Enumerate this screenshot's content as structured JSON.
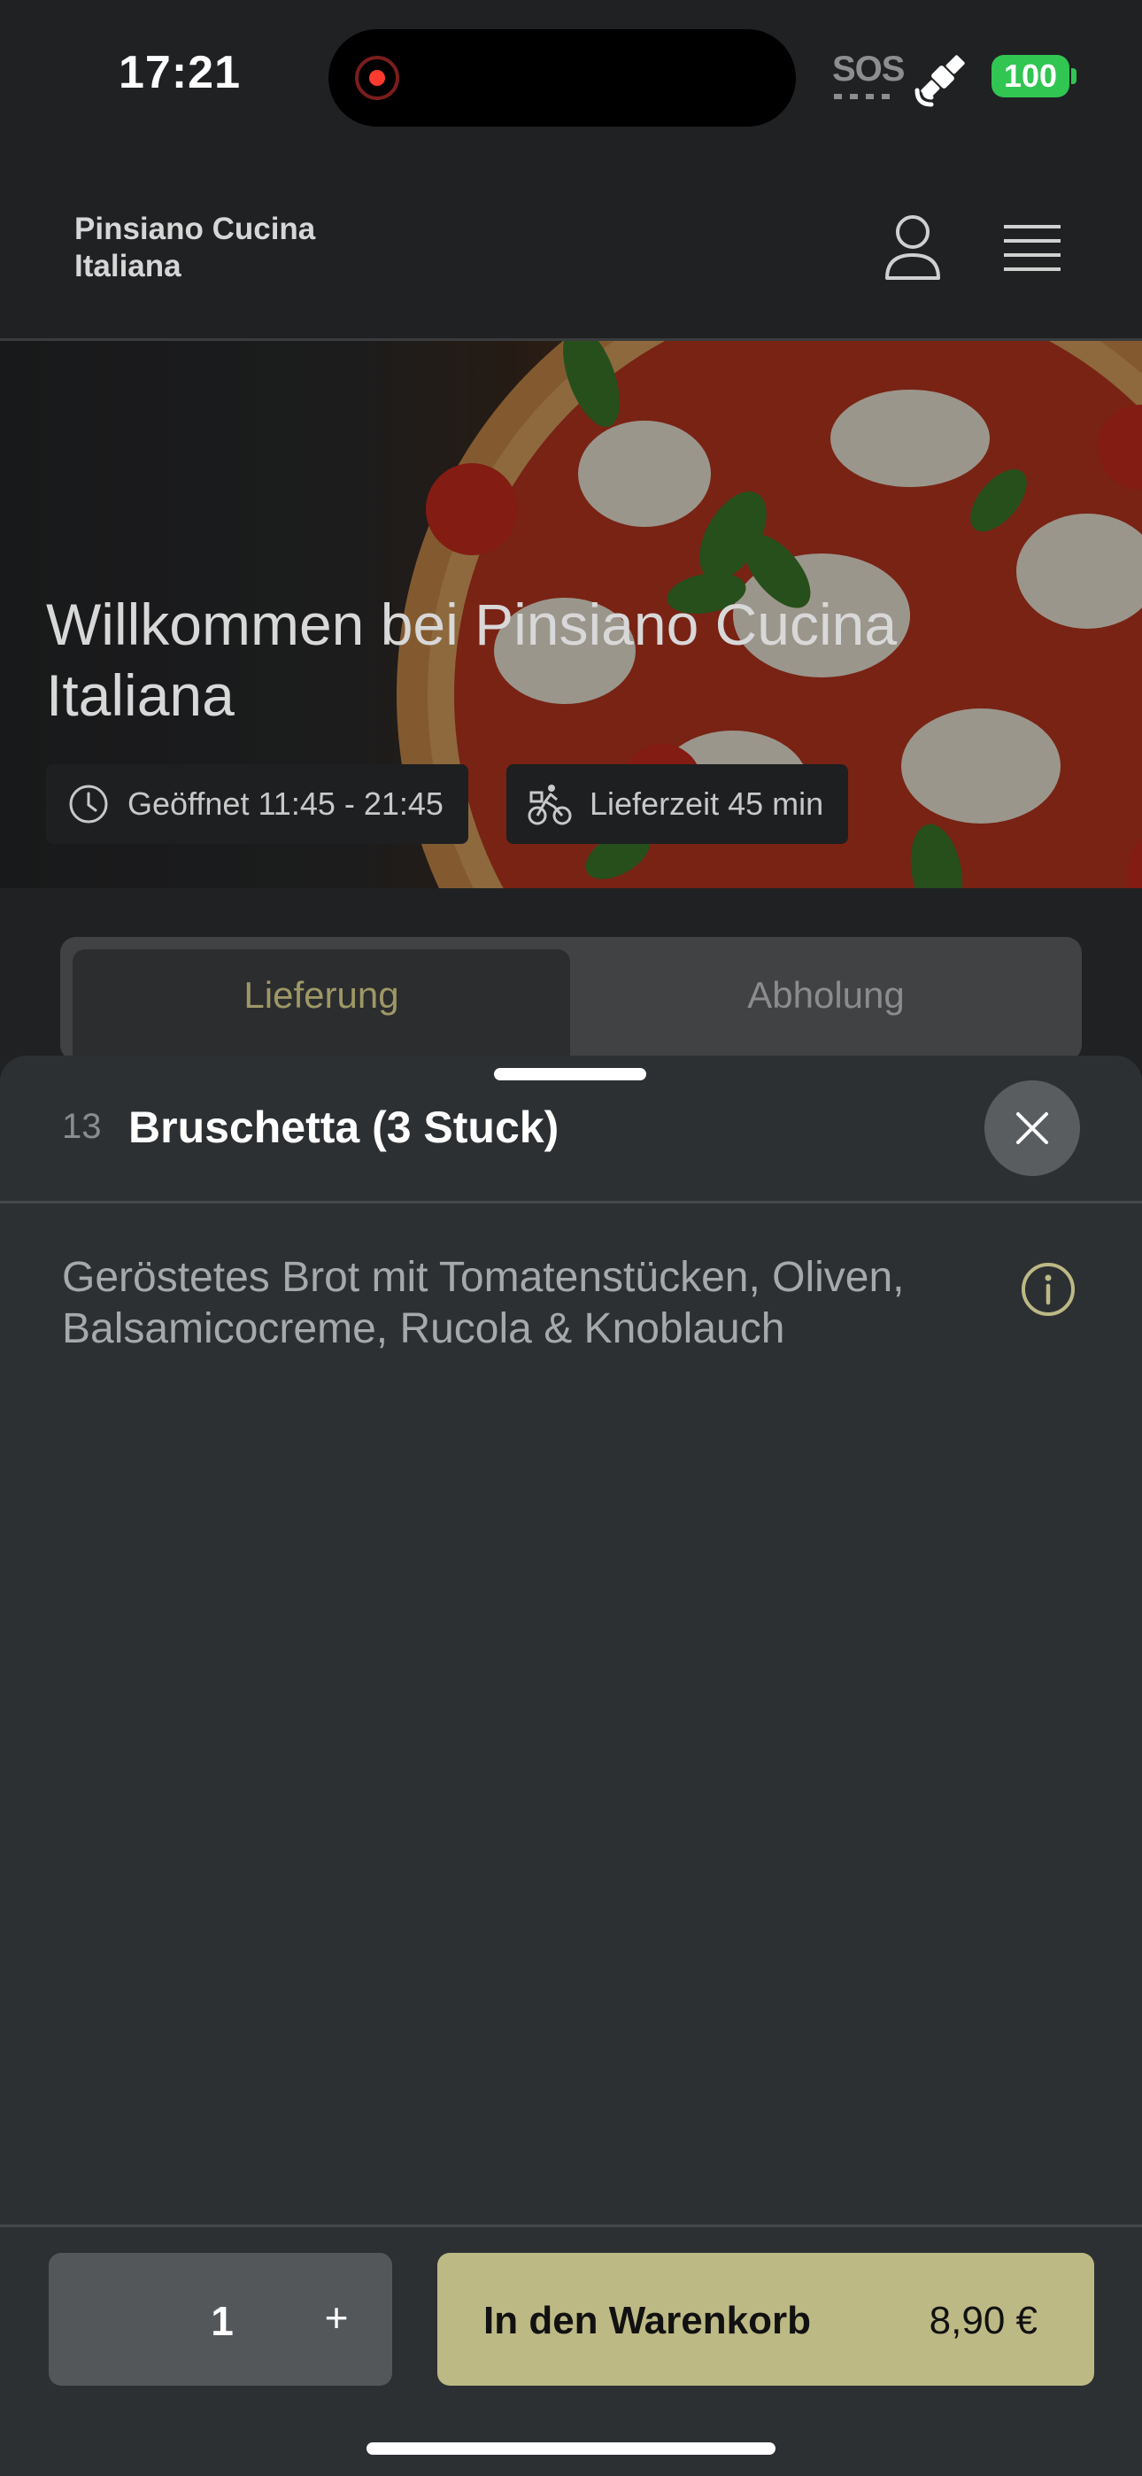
{
  "status_bar": {
    "time": "17:21",
    "sos": "SOS",
    "battery": "100",
    "colors": {
      "battery": "#31c552",
      "recording": "#ff3b30"
    }
  },
  "header": {
    "brand_line1": "Pinsiano Cucina",
    "brand_line2": "Italiana",
    "icons": [
      "user-icon",
      "menu-icon"
    ]
  },
  "hero": {
    "title": "Willkommen bei Pinsiano Cucina Italiana",
    "opening_hours": "Geöffnet 11:45 - 21:45",
    "delivery_time": "Lieferzeit 45 min",
    "icons": [
      "clock-icon",
      "bike-courier-icon"
    ]
  },
  "order_tabs": [
    {
      "label": "Lieferung",
      "active": true
    },
    {
      "label": "Abholung",
      "active": false
    }
  ],
  "item_sheet": {
    "number": "13",
    "title": "Bruschetta (3 Stuck)",
    "description": "Geröstetes Brot mit Tomatenstücken, Oliven, Balsamicocreme, Rucola & Knoblauch",
    "quantity": "1",
    "plus": "+",
    "add_to_cart": "In den Warenkorb",
    "price": "8,90 €",
    "colors": {
      "accent": "#bdb985",
      "sheet": "#2d3033"
    }
  }
}
